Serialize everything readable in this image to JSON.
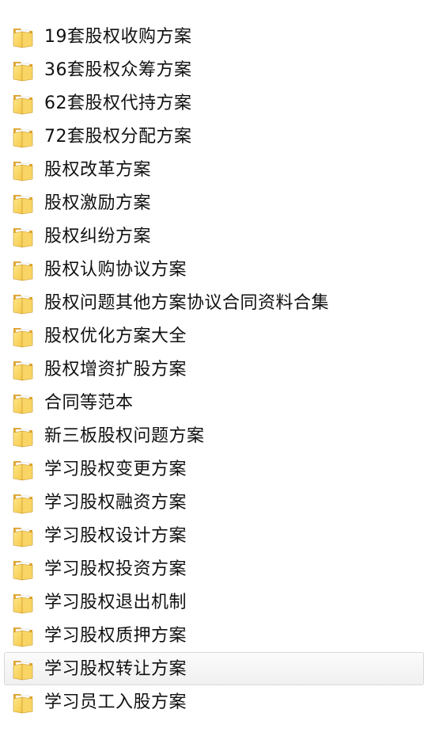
{
  "folders": [
    {
      "name": "19套股权收购方案"
    },
    {
      "name": "36套股权众筹方案"
    },
    {
      "name": "62套股权代持方案"
    },
    {
      "name": "72套股权分配方案"
    },
    {
      "name": "股权改革方案"
    },
    {
      "name": "股权激励方案"
    },
    {
      "name": "股权纠纷方案"
    },
    {
      "name": "股权认购协议方案"
    },
    {
      "name": "股权问题其他方案协议合同资料合集"
    },
    {
      "name": "股权优化方案大全"
    },
    {
      "name": "股权增资扩股方案"
    },
    {
      "name": "合同等范本"
    },
    {
      "name": "新三板股权问题方案"
    },
    {
      "name": "学习股权变更方案"
    },
    {
      "name": "学习股权融资方案"
    },
    {
      "name": "学习股权设计方案"
    },
    {
      "name": "学习股权投资方案"
    },
    {
      "name": "学习股权退出机制"
    },
    {
      "name": "学习股权质押方案"
    },
    {
      "name": "学习股权转让方案",
      "hovered": true
    },
    {
      "name": "学习员工入股方案"
    }
  ],
  "icon": "folder-icon",
  "colors": {
    "folder_front": "#f6c94a",
    "folder_back": "#e0a42a",
    "hover_border": "#d9d9d9",
    "text": "#111111"
  }
}
